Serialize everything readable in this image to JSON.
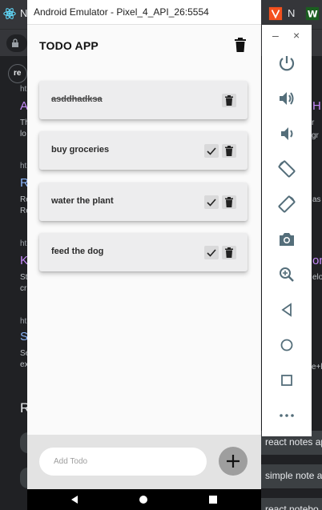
{
  "emulator": {
    "title": "Android Emulator - Pixel_4_API_26:5554"
  },
  "app": {
    "title": "TODO APP",
    "todos": [
      {
        "text": "asddhadksa",
        "completed": true
      },
      {
        "text": "buy groceries",
        "completed": false
      },
      {
        "text": "water the plant",
        "completed": false
      },
      {
        "text": "feed the dog",
        "completed": false
      }
    ],
    "add_placeholder": "Add Todo"
  },
  "side_toolbar": {
    "minimize": "–",
    "close": "×",
    "icons": [
      "power-icon",
      "volume-up-icon",
      "volume-down-icon",
      "rotate-left-icon",
      "rotate-right-icon",
      "camera-icon",
      "zoom-icon",
      "back-icon",
      "home-icon",
      "overview-icon",
      "more-icon"
    ]
  },
  "background": {
    "tab_letter": "N",
    "tab_letter2": "N",
    "pill_text": "re",
    "right_cards": [
      "react notes app",
      "simple note a",
      "react notebo"
    ],
    "left_snippets": [
      {
        "prefix": "ht",
        "link": "A",
        "lines": [
          "Th",
          "lo"
        ]
      },
      {
        "prefix": "ht",
        "link": "R",
        "lines": [
          "Re",
          "Re"
        ]
      },
      {
        "prefix": "ht",
        "link": "K",
        "lines": [
          "St",
          "cr"
        ]
      },
      {
        "prefix": "ht",
        "link": "S",
        "lines": [
          "Se",
          "ex"
        ]
      }
    ],
    "right_snippets": [
      "H",
      "r gr",
      "as",
      "on",
      "elo",
      "e+h"
    ],
    "r_heading": "R"
  },
  "colors": {
    "app_bg": "#fafafa",
    "card_bg": "#ededee",
    "bottom_bg": "#e3e3e3",
    "add_button": "#9e9e9e",
    "link_blue": "#8ab4f8",
    "link_visited": "#c58af9"
  }
}
